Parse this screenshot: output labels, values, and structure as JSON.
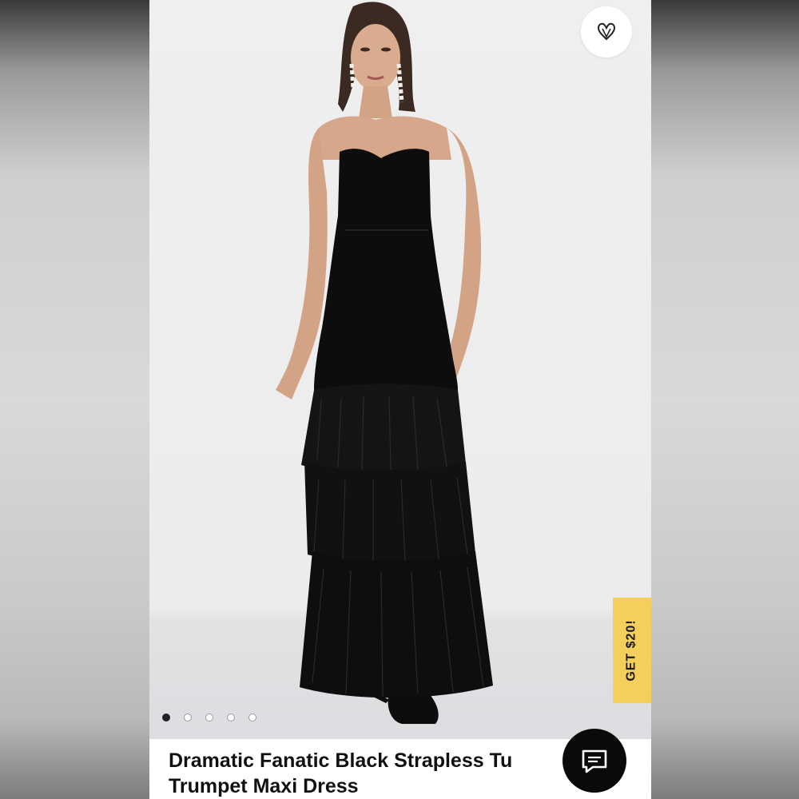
{
  "product": {
    "title_line1": "Dramatic Fanatic Black Strapless Tu",
    "title_line2": "Trumpet Maxi Dress",
    "image_alt": "Model wearing black strapless tiered tulle trumpet maxi dress"
  },
  "gallery": {
    "total_images": 5,
    "active_index": 0
  },
  "promo": {
    "label": "GET $20!",
    "color": "#f5cf5e"
  },
  "icons": {
    "favorite": "heart-icon",
    "chat": "chat-bubble-icon"
  },
  "colors": {
    "dress": "#0d0d0d",
    "background": "#efefef"
  }
}
